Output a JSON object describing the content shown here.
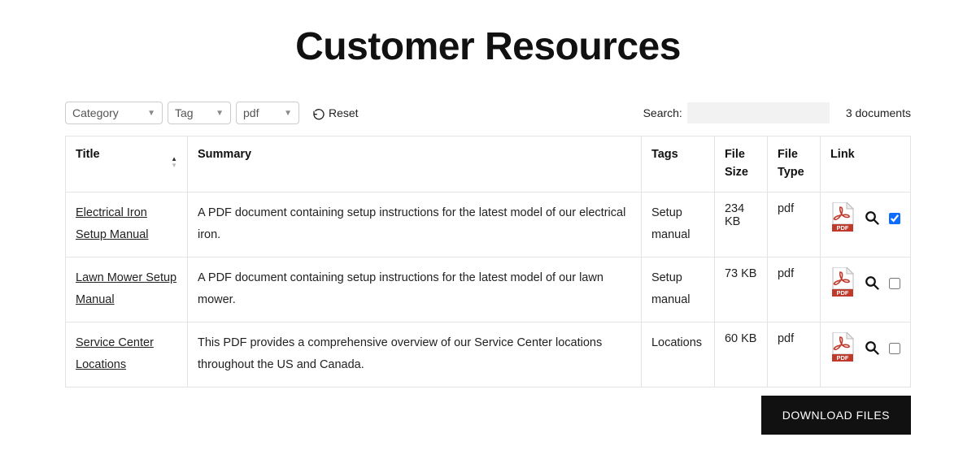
{
  "page": {
    "heading": "Customer Resources"
  },
  "filters": {
    "category": {
      "label": "Category"
    },
    "tag": {
      "label": "Tag"
    },
    "filetype": {
      "label": "pdf"
    },
    "reset_label": "Reset"
  },
  "search": {
    "label": "Search:",
    "value": ""
  },
  "doc_count_text": "3 documents",
  "columns": {
    "title": "Title",
    "summary": "Summary",
    "tags": "Tags",
    "file_size": "File Size",
    "file_type": "File Type",
    "link": "Link"
  },
  "rows": [
    {
      "title": "Electrical Iron Setup Manual",
      "summary": "A PDF document containing setup instructions for the latest model of our electrical iron.",
      "tags": "Setup manual",
      "file_size": "234 KB",
      "file_type": "pdf",
      "checked": true
    },
    {
      "title": "Lawn Mower Setup Manual",
      "summary": "A PDF document containing setup instructions for the latest model of our lawn mower.",
      "tags": "Setup manual",
      "file_size": "73 KB",
      "file_type": "pdf",
      "checked": false
    },
    {
      "title": "Service Center Locations",
      "summary": "This PDF provides a comprehensive overview of our Service Center locations throughout the US and Canada.",
      "tags": "Locations",
      "file_size": "60 KB",
      "file_type": "pdf",
      "checked": false
    }
  ],
  "download_button": "DOWNLOAD FILES"
}
